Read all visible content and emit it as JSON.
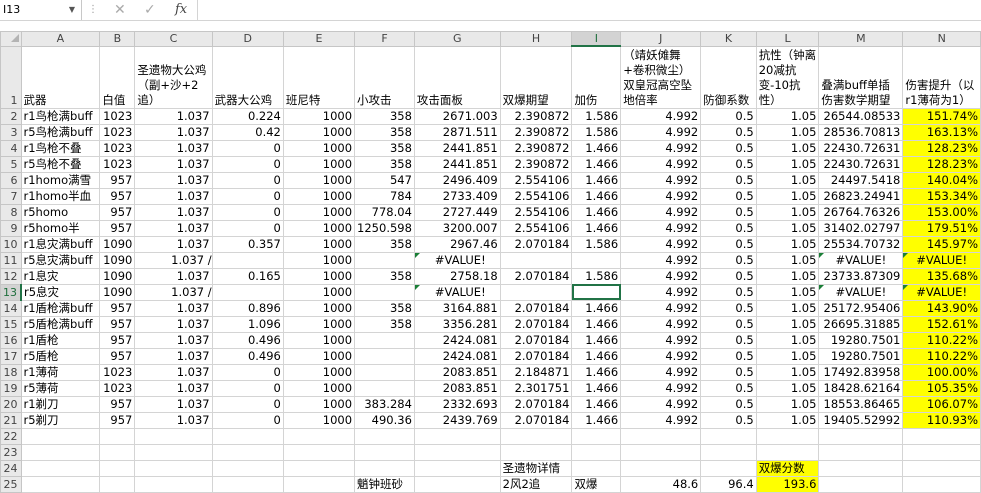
{
  "formula_bar": {
    "name_box": "I13",
    "formula": ""
  },
  "columns": [
    "A",
    "B",
    "C",
    "D",
    "E",
    "F",
    "G",
    "H",
    "I",
    "J",
    "K",
    "L",
    "M",
    "N"
  ],
  "selected_column": "I",
  "selected_row": "13",
  "header_row": [
    "武器",
    "白值",
    "圣遗物大公鸡（副+沙+2追）",
    "武器大公鸡",
    "班尼特",
    "小攻击",
    "攻击面板",
    "双爆期望",
    "加伤",
    "（靖妖傩舞+卷积微尘）双皇冠高空坠地倍率",
    "防御系数",
    "抗性（钟离20减抗变-10抗性）",
    "叠满buff单插伤害数学期望",
    "伤害提升（以r1薄荷为1）"
  ],
  "rows": [
    {
      "n": "2",
      "c": [
        "r1鸟枪满buff",
        "1023",
        "1.037",
        "0.224",
        "1000",
        "358",
        "2671.003",
        "2.390872",
        "1.586",
        "4.992",
        "0.5",
        "1.05",
        "26544.08533",
        "151.74%"
      ]
    },
    {
      "n": "3",
      "c": [
        "r5鸟枪满buff",
        "1023",
        "1.037",
        "0.42",
        "1000",
        "358",
        "2871.511",
        "2.390872",
        "1.586",
        "4.992",
        "0.5",
        "1.05",
        "28536.70813",
        "163.13%"
      ]
    },
    {
      "n": "4",
      "c": [
        "r1鸟枪不叠",
        "1023",
        "1.037",
        "0",
        "1000",
        "358",
        "2441.851",
        "2.390872",
        "1.466",
        "4.992",
        "0.5",
        "1.05",
        "22430.72631",
        "128.23%"
      ]
    },
    {
      "n": "5",
      "c": [
        "r5鸟枪不叠",
        "1023",
        "1.037",
        "0",
        "1000",
        "358",
        "2441.851",
        "2.390872",
        "1.466",
        "4.992",
        "0.5",
        "1.05",
        "22430.72631",
        "128.23%"
      ]
    },
    {
      "n": "6",
      "c": [
        "r1homo满雪",
        "957",
        "1.037",
        "0",
        "1000",
        "547",
        "2496.409",
        "2.554106",
        "1.466",
        "4.992",
        "0.5",
        "1.05",
        "24497.5418",
        "140.04%"
      ]
    },
    {
      "n": "7",
      "c": [
        "r1homo半血",
        "957",
        "1.037",
        "0",
        "1000",
        "784",
        "2733.409",
        "2.554106",
        "1.466",
        "4.992",
        "0.5",
        "1.05",
        "26823.24941",
        "153.34%"
      ]
    },
    {
      "n": "8",
      "c": [
        "r5homo",
        "957",
        "1.037",
        "0",
        "1000",
        "778.04",
        "2727.449",
        "2.554106",
        "1.466",
        "4.992",
        "0.5",
        "1.05",
        "26764.76326",
        "153.00%"
      ]
    },
    {
      "n": "9",
      "c": [
        "r5homo半",
        "957",
        "1.037",
        "0",
        "1000",
        "1250.598",
        "3200.007",
        "2.554106",
        "1.466",
        "4.992",
        "0.5",
        "1.05",
        "31402.02797",
        "179.51%"
      ]
    },
    {
      "n": "10",
      "c": [
        "r1息灾满buff",
        "1090",
        "1.037",
        "0.357",
        "1000",
        "358",
        "2967.46",
        "2.070184",
        "1.586",
        "4.992",
        "0.5",
        "1.05",
        "25534.70732",
        "145.97%"
      ]
    },
    {
      "n": "11",
      "c": [
        "r5息灾满buff",
        "1090",
        "1.037 /",
        "",
        "1000",
        "",
        "#VALUE!",
        "",
        "",
        "4.992",
        "0.5",
        "1.05",
        "#VALUE!",
        "#VALUE!"
      ]
    },
    {
      "n": "12",
      "c": [
        "r1息灾",
        "1090",
        "1.037",
        "0.165",
        "1000",
        "358",
        "2758.18",
        "2.070184",
        "1.586",
        "4.992",
        "0.5",
        "1.05",
        "23733.87309",
        "135.68%"
      ]
    },
    {
      "n": "13",
      "c": [
        "r5息灾",
        "1090",
        "1.037 /",
        "",
        "1000",
        "",
        "#VALUE!",
        "",
        "",
        "4.992",
        "0.5",
        "1.05",
        "#VALUE!",
        "#VALUE!"
      ]
    },
    {
      "n": "14",
      "c": [
        "r1盾枪满buff",
        "957",
        "1.037",
        "0.896",
        "1000",
        "358",
        "3164.881",
        "2.070184",
        "1.466",
        "4.992",
        "0.5",
        "1.05",
        "25172.95406",
        "143.90%"
      ]
    },
    {
      "n": "15",
      "c": [
        "r5盾枪满buff",
        "957",
        "1.037",
        "1.096",
        "1000",
        "358",
        "3356.281",
        "2.070184",
        "1.466",
        "4.992",
        "0.5",
        "1.05",
        "26695.31885",
        "152.61%"
      ]
    },
    {
      "n": "16",
      "c": [
        "r1盾枪",
        "957",
        "1.037",
        "0.496",
        "1000",
        "",
        "2424.081",
        "2.070184",
        "1.466",
        "4.992",
        "0.5",
        "1.05",
        "19280.7501",
        "110.22%"
      ]
    },
    {
      "n": "17",
      "c": [
        "r5盾枪",
        "957",
        "1.037",
        "0.496",
        "1000",
        "",
        "2424.081",
        "2.070184",
        "1.466",
        "4.992",
        "0.5",
        "1.05",
        "19280.7501",
        "110.22%"
      ]
    },
    {
      "n": "18",
      "c": [
        "r1薄荷",
        "1023",
        "1.037",
        "0",
        "1000",
        "",
        "2083.851",
        "2.184871",
        "1.466",
        "4.992",
        "0.5",
        "1.05",
        "17492.83958",
        "100.00%"
      ]
    },
    {
      "n": "19",
      "c": [
        "r5薄荷",
        "1023",
        "1.037",
        "0",
        "1000",
        "",
        "2083.851",
        "2.301751",
        "1.466",
        "4.992",
        "0.5",
        "1.05",
        "18428.62164",
        "105.35%"
      ]
    },
    {
      "n": "20",
      "c": [
        "r1剃刀",
        "957",
        "1.037",
        "0",
        "1000",
        "383.284",
        "2332.693",
        "2.070184",
        "1.466",
        "4.992",
        "0.5",
        "1.05",
        "18553.86465",
        "106.07%"
      ]
    },
    {
      "n": "21",
      "c": [
        "r5剃刀",
        "957",
        "1.037",
        "0",
        "1000",
        "490.36",
        "2439.769",
        "2.070184",
        "1.466",
        "4.992",
        "0.5",
        "1.05",
        "19405.52992",
        "110.93%"
      ]
    }
  ],
  "row22": {
    "n": "22"
  },
  "row23": {
    "n": "23"
  },
  "row24": {
    "n": "24",
    "H": "圣遗物详情",
    "L": "双爆分数"
  },
  "row25": {
    "n": "25",
    "F": "魈钟班砂",
    "H": "2风2追",
    "I": "双爆",
    "J": "48.6",
    "K": "96.4",
    "L": "193.6"
  },
  "colors": {
    "highlight": "#ffff00",
    "selection": "#217346",
    "grid": "#d4d4d4",
    "header_bg": "#e9e9e9"
  }
}
